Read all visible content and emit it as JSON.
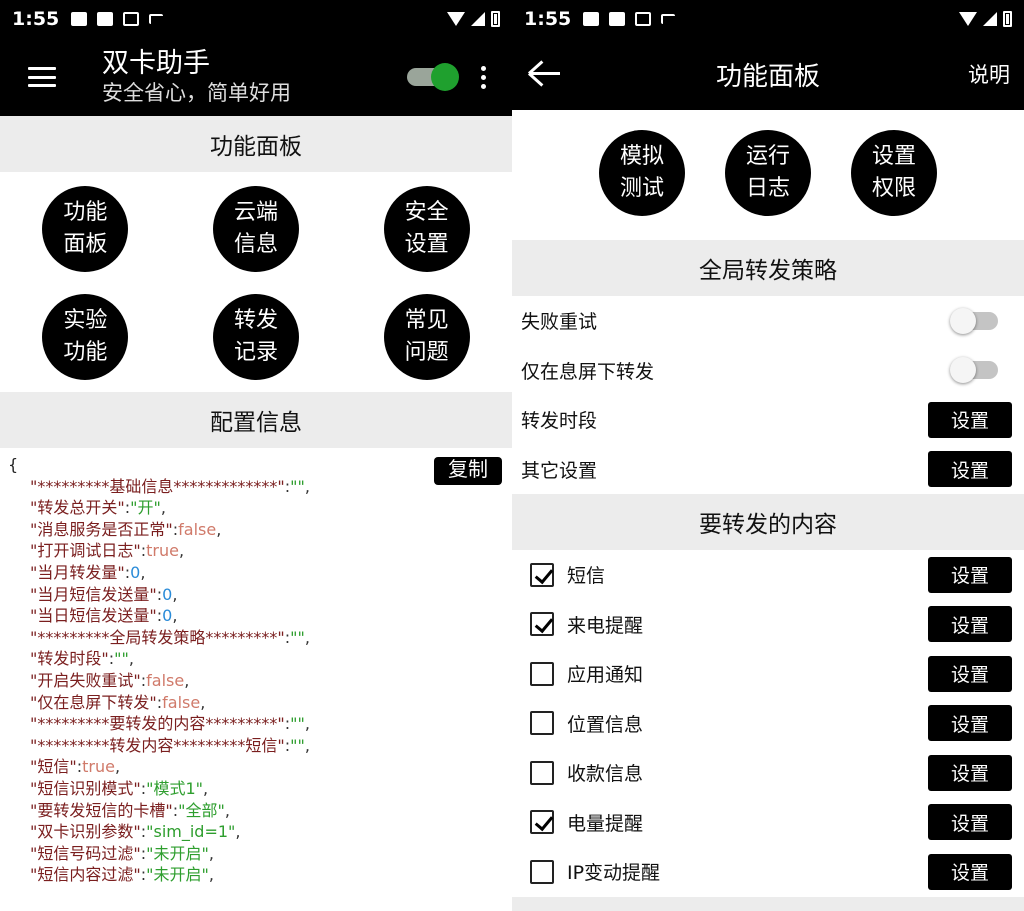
{
  "left": {
    "status": {
      "time": "1:55"
    },
    "appbar": {
      "title": "双卡助手",
      "subtitle": "安全省心，简单好用"
    },
    "panel_title": "功能面板",
    "buttons": [
      {
        "line1": "功能",
        "line2": "面板"
      },
      {
        "line1": "云端",
        "line2": "信息"
      },
      {
        "line1": "安全",
        "line2": "设置"
      },
      {
        "line1": "实验",
        "line2": "功能"
      },
      {
        "line1": "转发",
        "line2": "记录"
      },
      {
        "line1": "常见",
        "line2": "问题"
      }
    ],
    "config_title": "配置信息",
    "copy_label": "复制",
    "config": {
      "open_brace": "{",
      "lines": [
        {
          "key": "\"*********基础信息*************\"",
          "value": "\"\"",
          "type": "str"
        },
        {
          "key": "\"转发总开关\"",
          "value": "\"开\"",
          "type": "str"
        },
        {
          "key": "\"消息服务是否正常\"",
          "value": "false",
          "type": "bool"
        },
        {
          "key": "\"打开调试日志\"",
          "value": "true",
          "type": "bool"
        },
        {
          "key": "\"当月转发量\"",
          "value": "0",
          "type": "num"
        },
        {
          "key": "\"当月短信发送量\"",
          "value": "0",
          "type": "num"
        },
        {
          "key": "\"当日短信发送量\"",
          "value": "0",
          "type": "num"
        },
        {
          "key": "\"*********全局转发策略*********\"",
          "value": "\"\"",
          "type": "str"
        },
        {
          "key": "\"转发时段\"",
          "value": "\"\"",
          "type": "str"
        },
        {
          "key": "\"开启失败重试\"",
          "value": "false",
          "type": "bool"
        },
        {
          "key": "\"仅在息屏下转发\"",
          "value": "false",
          "type": "bool"
        },
        {
          "key": "\"*********要转发的内容*********\"",
          "value": "\"\"",
          "type": "str"
        },
        {
          "key": "\"*********转发内容*********短信\"",
          "value": "\"\"",
          "type": "str"
        },
        {
          "key": "\"短信\"",
          "value": "true",
          "type": "bool"
        },
        {
          "key": "\"短信识别模式\"",
          "value": "\"模式1\"",
          "type": "str"
        },
        {
          "key": "\"要转发短信的卡槽\"",
          "value": "\"全部\"",
          "type": "str"
        },
        {
          "key": "\"双卡识别参数\"",
          "value": "\"sim_id=1\"",
          "type": "str"
        },
        {
          "key": "\"短信号码过滤\"",
          "value": "\"未开启\"",
          "type": "str"
        },
        {
          "key": "\"短信内容过滤\"",
          "value": "\"未开启\"",
          "type": "str"
        }
      ]
    }
  },
  "right": {
    "status": {
      "time": "1:55"
    },
    "appbar": {
      "title": "功能面板",
      "help": "说明"
    },
    "top_buttons": [
      {
        "line1": "模拟",
        "line2": "测试"
      },
      {
        "line1": "运行",
        "line2": "日志"
      },
      {
        "line1": "设置",
        "line2": "权限"
      }
    ],
    "strategy_title": "全局转发策略",
    "strategy": {
      "retry": "失败重试",
      "screen_off": "仅在息屏下转发",
      "period": "转发时段",
      "other": "其它设置",
      "set_label": "设置"
    },
    "content_title": "要转发的内容",
    "content_items": [
      {
        "label": "短信",
        "checked": true
      },
      {
        "label": "来电提醒",
        "checked": true
      },
      {
        "label": "应用通知",
        "checked": false
      },
      {
        "label": "位置信息",
        "checked": false
      },
      {
        "label": "收款信息",
        "checked": false
      },
      {
        "label": "电量提醒",
        "checked": true
      },
      {
        "label": "IP变动提醒",
        "checked": false
      }
    ]
  }
}
